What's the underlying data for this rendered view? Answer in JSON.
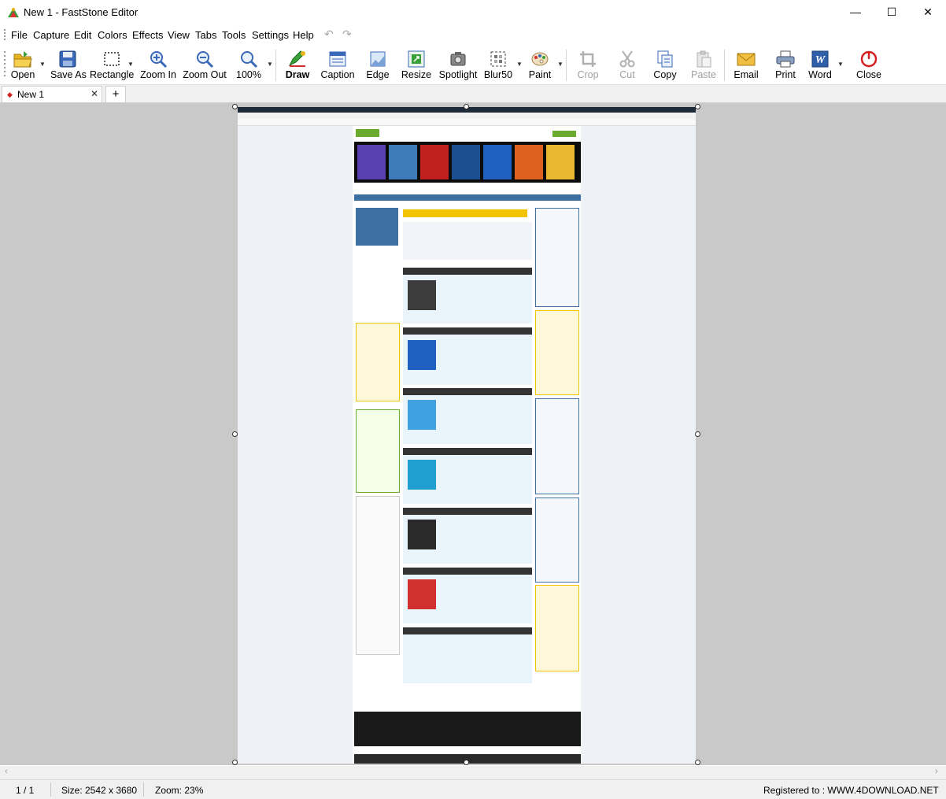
{
  "window": {
    "title": "New 1 - FastStone Editor",
    "minimize_glyph": "—",
    "maximize_glyph": "☐",
    "close_glyph": "✕"
  },
  "menu": {
    "items": [
      "File",
      "Capture",
      "Edit",
      "Colors",
      "Effects",
      "View",
      "Tabs",
      "Tools",
      "Settings",
      "Help"
    ],
    "undo_glyph": "↶",
    "redo_glyph": "↷"
  },
  "toolbar": {
    "open": "Open",
    "save_as": "Save As",
    "rectangle": "Rectangle",
    "zoom_in": "Zoom In",
    "zoom_out": "Zoom Out",
    "zoom_pct": "100%",
    "draw": "Draw",
    "caption": "Caption",
    "edge": "Edge",
    "resize": "Resize",
    "spotlight": "Spotlight",
    "blur": "Blur50",
    "paint": "Paint",
    "crop": "Crop",
    "cut": "Cut",
    "copy": "Copy",
    "paste": "Paste",
    "email": "Email",
    "print": "Print",
    "word": "Word",
    "close": "Close"
  },
  "tabs": {
    "active_label": "New 1",
    "close_glyph": "✕",
    "add_glyph": "+"
  },
  "status": {
    "page": "1 / 1",
    "size": "Size: 2542 x 3680",
    "zoom": "Zoom: 23%",
    "registered": "Registered to : WWW.4DOWNLOAD.NET"
  },
  "colors": {
    "accent_blue": "#2f5fa8",
    "site_green": "#6aab2f",
    "site_yellow": "#f2c400",
    "site_header_blue": "#3d6fa3",
    "close_red": "#d42020"
  },
  "icons": [
    "app-icon",
    "open-icon",
    "save-icon",
    "rectangle-icon",
    "zoom-in-icon",
    "zoom-out-icon",
    "zoom-100-icon",
    "draw-icon",
    "caption-icon",
    "edge-icon",
    "resize-icon",
    "spotlight-icon",
    "blur-icon",
    "paint-icon",
    "crop-icon",
    "cut-icon",
    "copy-icon",
    "paste-icon",
    "email-icon",
    "print-icon",
    "word-icon",
    "close-icon"
  ]
}
